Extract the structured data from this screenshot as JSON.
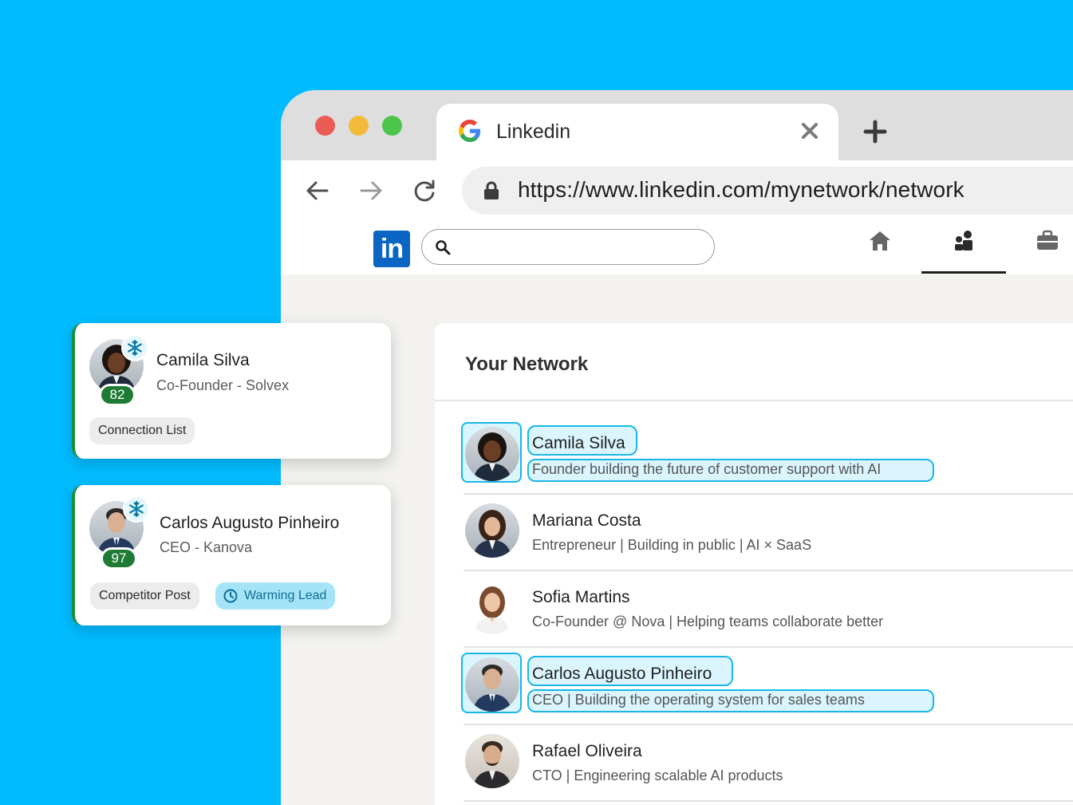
{
  "browser": {
    "tab_title": "Linkedin",
    "url": "https://www.linkedin.com/mynetwork/network",
    "icons": [
      "google-icon",
      "close-icon",
      "plus-icon",
      "back-arrow-icon",
      "forward-arrow-icon",
      "reload-icon",
      "lock-icon"
    ]
  },
  "linkedin": {
    "logo_text": "in",
    "search_placeholder": "",
    "nav_icons": [
      "home-icon",
      "network-icon",
      "jobs-icon"
    ],
    "active_nav": "network"
  },
  "network": {
    "title": "Your Network",
    "rows": [
      {
        "name": "Camila Silva",
        "headline": "Founder building the future of customer support with AI",
        "highlighted": true
      },
      {
        "name": "Mariana Costa",
        "headline": "Entrepreneur | Building in public | AI × SaaS",
        "highlighted": false
      },
      {
        "name": "Sofia Martins",
        "headline": "Co-Founder @ Nova | Helping teams collaborate better",
        "highlighted": false
      },
      {
        "name": "Carlos Augusto Pinheiro",
        "headline": "CEO | Building the operating system for sales teams",
        "highlighted": true
      },
      {
        "name": "Rafael Oliveira",
        "headline": "CTO | Engineering scalable AI products",
        "highlighted": false
      }
    ]
  },
  "cards": [
    {
      "name": "Camila Silva",
      "title": "Co-Founder - Solvex",
      "score": "82",
      "tags": [
        "Connection List"
      ]
    },
    {
      "name": "Carlos Augusto Pinheiro",
      "title": "CEO - Kanova",
      "score": "97",
      "tags": [
        "Competitor Post",
        "Warming Lead"
      ]
    }
  ],
  "colors": {
    "background": "#00BCFF",
    "linkedin_blue": "#0A66C2",
    "highlight": "#1AB6E8",
    "score_green": "#1E7B34",
    "warm_chip": "#A5E4F7"
  }
}
